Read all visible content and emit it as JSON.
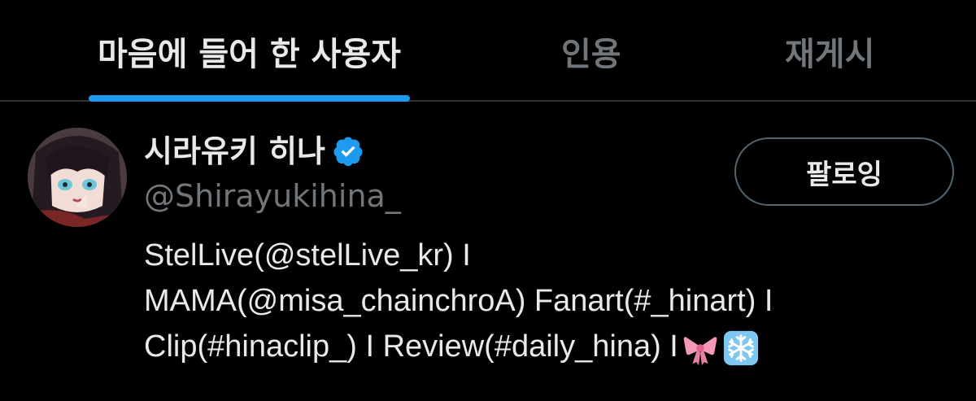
{
  "tabs": [
    {
      "label": "마음에 들어 한 사용자",
      "active": true
    },
    {
      "label": "인용",
      "active": false
    },
    {
      "label": "재게시",
      "active": false
    }
  ],
  "user": {
    "display_name": "시라유키 히나",
    "handle": "@Shirayukihina_",
    "verified": true,
    "follow_label": "팔로잉",
    "bio_lines": [
      "StelLive(@stelLive_kr) I",
      "MAMA(@misa_chainchroA) Fanart(#_hinart) I",
      "Clip(#hinaclip_) I Review(#daily_hina) I"
    ],
    "bio_emojis": [
      "ribbon-emoji",
      "snowflake-emoji"
    ]
  },
  "colors": {
    "background": "#000000",
    "primary_text": "#e7e9ea",
    "secondary_text": "#71767b",
    "accent": "#1d9bf0",
    "divider": "#2f3336"
  }
}
